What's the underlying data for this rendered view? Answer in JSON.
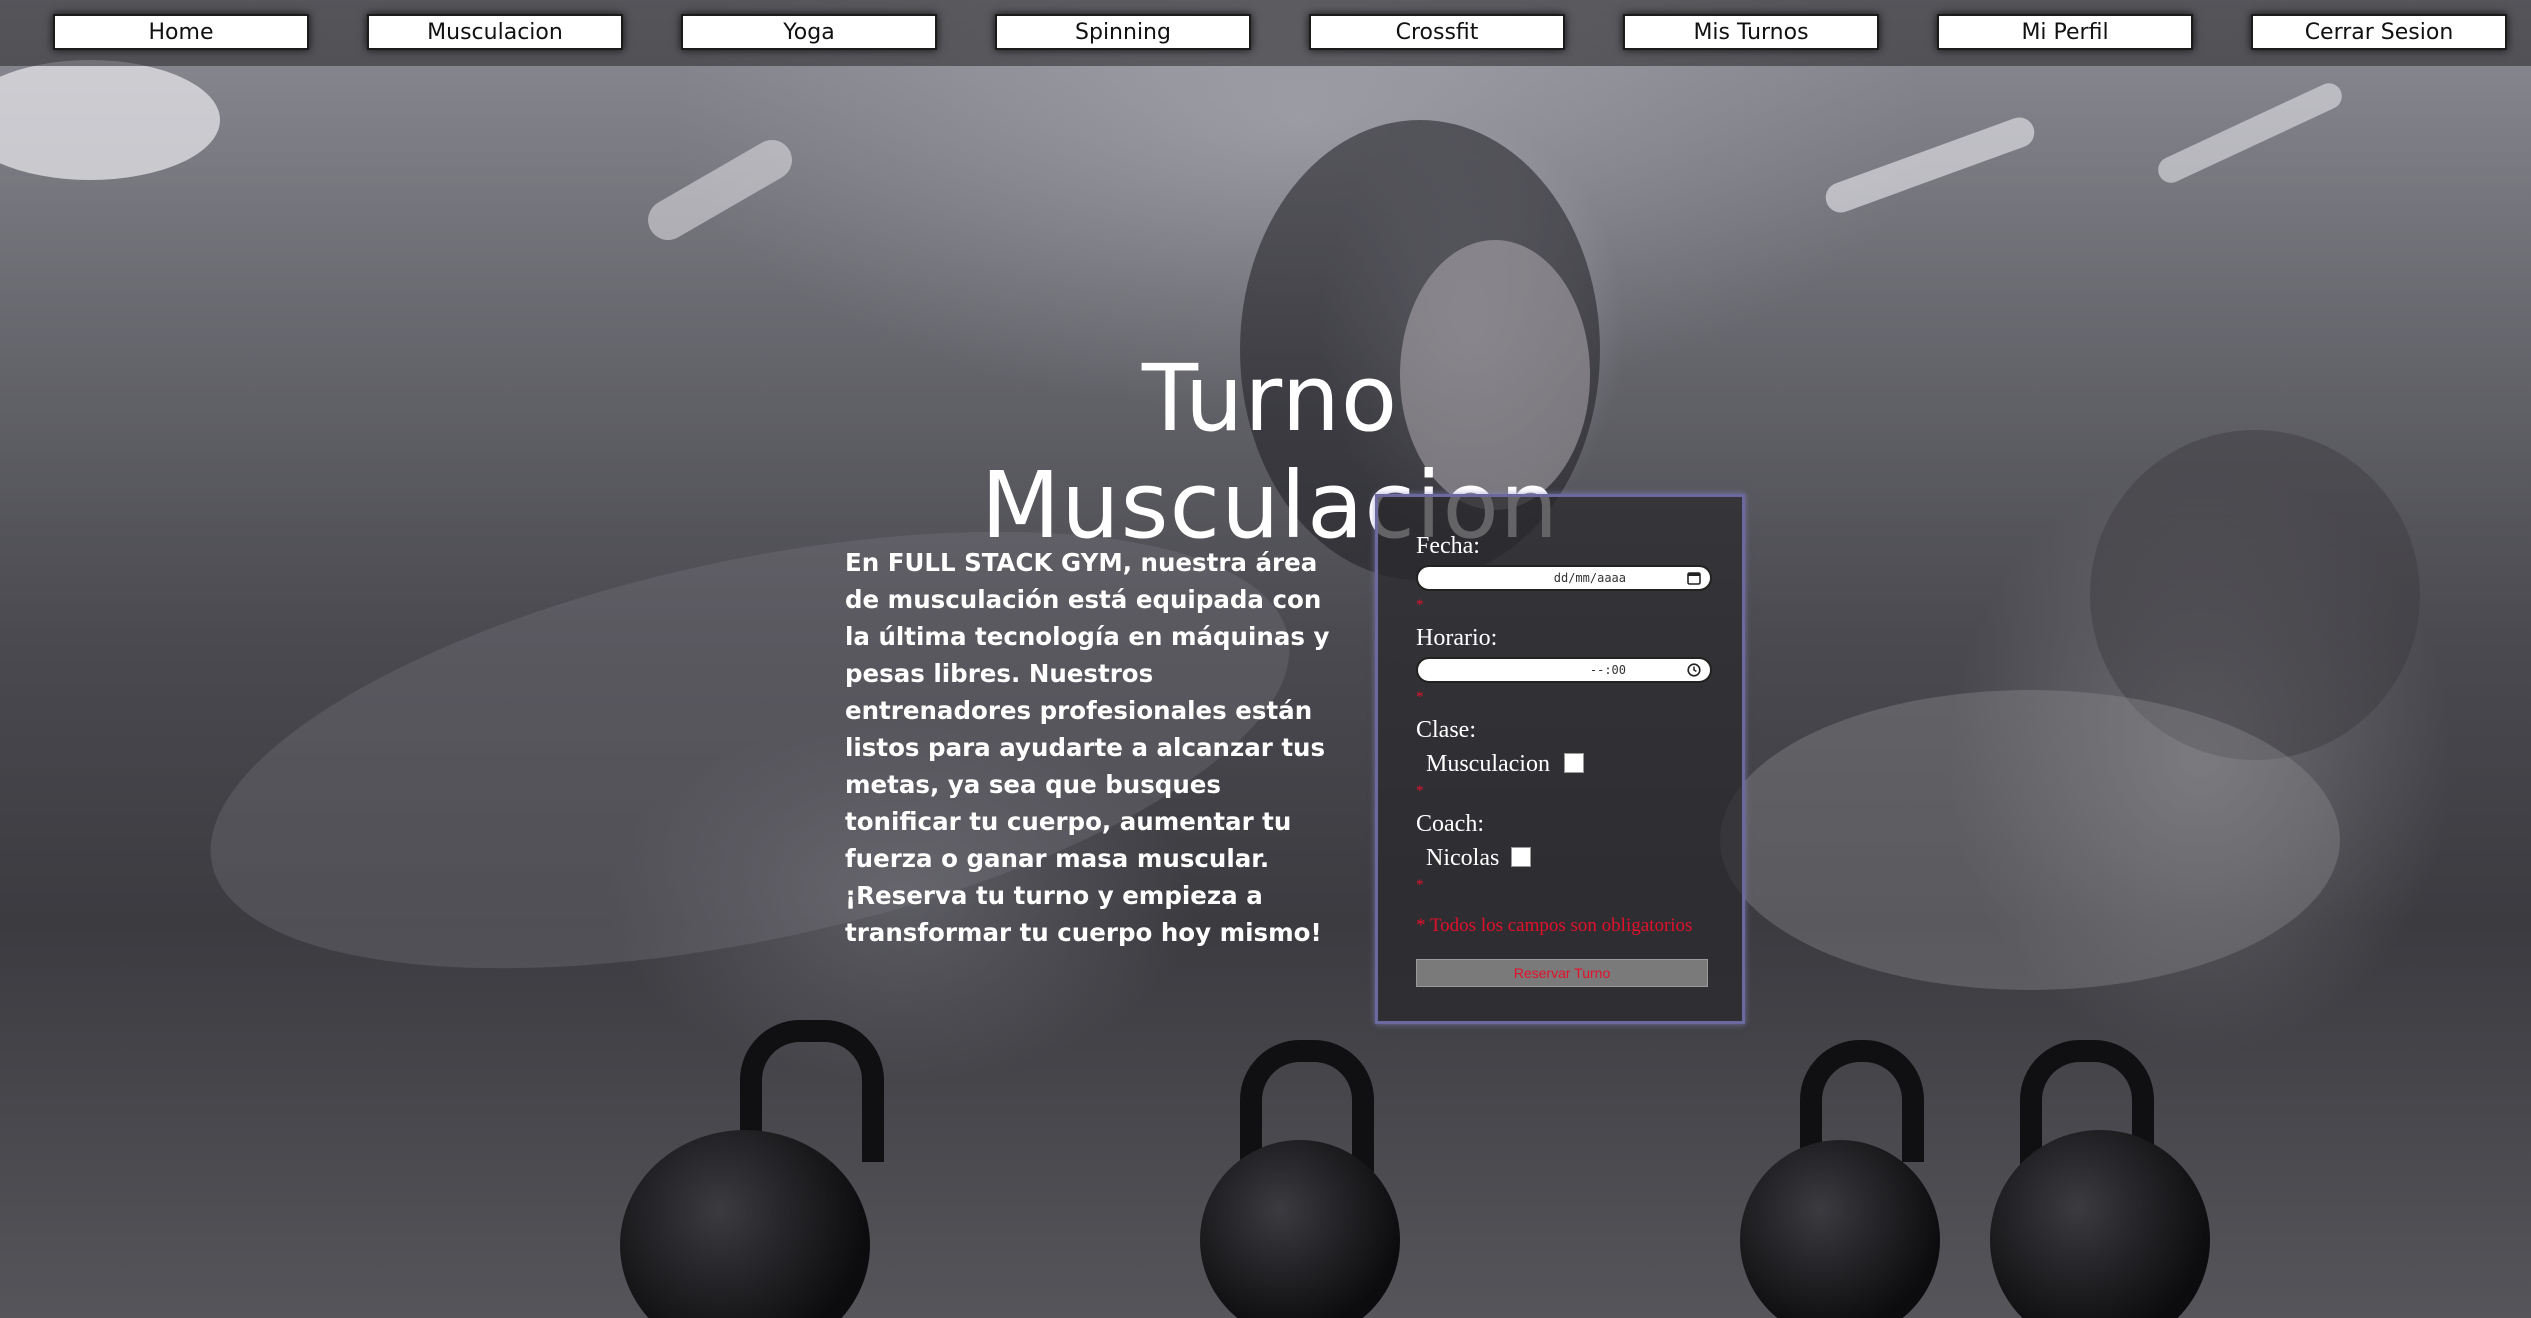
{
  "nav": {
    "items": [
      {
        "label": "Home"
      },
      {
        "label": "Musculacion"
      },
      {
        "label": "Yoga"
      },
      {
        "label": "Spinning"
      },
      {
        "label": "Crossfit"
      },
      {
        "label": "Mis Turnos"
      },
      {
        "label": "Mi Perfil"
      },
      {
        "label": "Cerrar Sesion"
      }
    ]
  },
  "page": {
    "title": "Turno Musculacion",
    "description": "En FULL STACK GYM, nuestra área de musculación está equipada con la última tecnología en máquinas y pesas libres. Nuestros entrenadores profesionales están listos para ayudarte a alcanzar tus metas, ya sea que busques tonificar tu cuerpo, aumentar tu fuerza o ganar masa muscular. ¡Reserva tu turno y empieza a transformar tu cuerpo hoy mismo!"
  },
  "form": {
    "fecha_label": "Fecha:",
    "fecha_value": "dd/mm/aaaa",
    "fecha_icon": "calendar-icon",
    "horario_label": "Horario:",
    "horario_value": "--:00",
    "horario_icon": "clock-icon",
    "clase_label": "Clase:",
    "clase_option": "Musculacion",
    "coach_label": "Coach:",
    "coach_option": "Nicolas",
    "required_mark": "*",
    "required_note": "* Todos los campos son obligatorios",
    "submit_label": "Reservar Turno"
  },
  "colors": {
    "error_red": "#e4102a",
    "form_border": "#6c68a0",
    "nav_button_bg": "#ffffff"
  }
}
